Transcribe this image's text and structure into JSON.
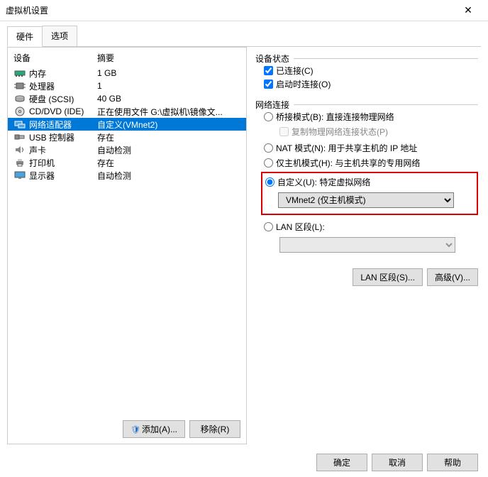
{
  "title": "虚拟机设置",
  "tabs": {
    "hardware": "硬件",
    "options": "选项"
  },
  "devTable": {
    "colDevice": "设备",
    "colSummary": "摘要",
    "rows": [
      {
        "name": "内存",
        "summary": "1 GB",
        "icon": "memory"
      },
      {
        "name": "处理器",
        "summary": "1",
        "icon": "cpu"
      },
      {
        "name": "硬盘 (SCSI)",
        "summary": "40 GB",
        "icon": "disk"
      },
      {
        "name": "CD/DVD (IDE)",
        "summary": "正在使用文件 G:\\虚拟机\\镜像文...",
        "icon": "cd"
      },
      {
        "name": "网络适配器",
        "summary": "自定义(VMnet2)",
        "icon": "net",
        "selected": true
      },
      {
        "name": "USB 控制器",
        "summary": "存在",
        "icon": "usb"
      },
      {
        "name": "声卡",
        "summary": "自动检测",
        "icon": "sound"
      },
      {
        "name": "打印机",
        "summary": "存在",
        "icon": "printer"
      },
      {
        "name": "显示器",
        "summary": "自动检测",
        "icon": "display"
      }
    ]
  },
  "leftButtons": {
    "add": "添加(A)...",
    "remove": "移除(R)"
  },
  "devState": {
    "title": "设备状态",
    "connected": "已连接(C)",
    "connectAtPower": "启动时连接(O)"
  },
  "netConn": {
    "title": "网络连接",
    "bridged": "桥接模式(B): 直接连接物理网络",
    "replicate": "复制物理网络连接状态(P)",
    "nat": "NAT 模式(N): 用于共享主机的 IP 地址",
    "hostOnly": "仅主机模式(H): 与主机共享的专用网络",
    "custom": "自定义(U): 特定虚拟网络",
    "customValue": "VMnet2 (仅主机模式)",
    "lanSegment": "LAN 区段(L):",
    "lanValue": ""
  },
  "rightButtons": {
    "lan": "LAN 区段(S)...",
    "advanced": "高级(V)..."
  },
  "footer": {
    "ok": "确定",
    "cancel": "取消",
    "help": "帮助"
  }
}
